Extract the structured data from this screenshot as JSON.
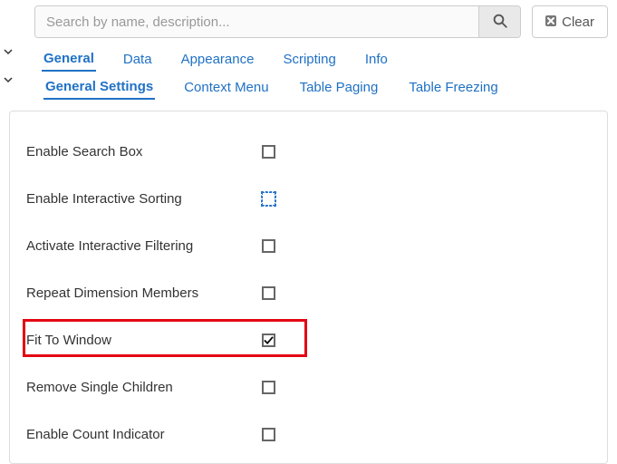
{
  "search": {
    "placeholder": "Search by name, description...",
    "value": "",
    "clear_label": "Clear"
  },
  "tabs_primary": {
    "items": [
      {
        "label": "General",
        "active": true
      },
      {
        "label": "Data"
      },
      {
        "label": "Appearance"
      },
      {
        "label": "Scripting"
      },
      {
        "label": "Info"
      }
    ]
  },
  "tabs_secondary": {
    "items": [
      {
        "label": "General Settings",
        "active": true
      },
      {
        "label": "Context Menu"
      },
      {
        "label": "Table Paging"
      },
      {
        "label": "Table Freezing"
      }
    ]
  },
  "options": [
    {
      "label": "Enable Search Box",
      "checked": false,
      "focused": false,
      "highlight": false
    },
    {
      "label": "Enable Interactive Sorting",
      "checked": false,
      "focused": true,
      "highlight": false
    },
    {
      "label": "Activate Interactive Filtering",
      "checked": false,
      "focused": false,
      "highlight": false
    },
    {
      "label": "Repeat Dimension Members",
      "checked": false,
      "focused": false,
      "highlight": false
    },
    {
      "label": "Fit To Window",
      "checked": true,
      "focused": false,
      "highlight": true
    },
    {
      "label": "Remove Single Children",
      "checked": false,
      "focused": false,
      "highlight": false
    },
    {
      "label": "Enable Count Indicator",
      "checked": false,
      "focused": false,
      "highlight": false
    }
  ]
}
